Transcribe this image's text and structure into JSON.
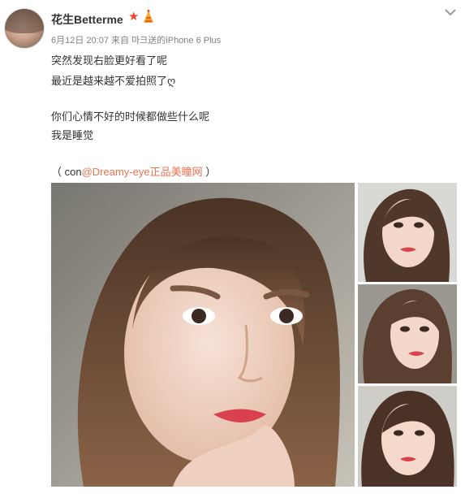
{
  "post": {
    "username": "花生Betterme",
    "meta": "6月12日 20:07 来自 마크送的iPhone 6 Plus",
    "text_lines": [
      "突然发现右脸更好看了呢",
      "最近是越来越不爱拍照了ღ",
      "你们心情不好的时候都做些什么呢",
      "我是睡觉"
    ],
    "credit": {
      "prefix": "（ con",
      "link": "@Dreamy-eye正品美瞳网",
      "suffix": " ）"
    }
  },
  "icons": {
    "verified": "star-icon",
    "badge": "party-hat-icon",
    "menu": "chevron-down-icon"
  },
  "colors": {
    "link": "#eb7350",
    "star": "#e8492d",
    "meta": "#808080"
  },
  "photos": [
    "main-selfie",
    "thumb-1",
    "thumb-2",
    "thumb-3"
  ]
}
